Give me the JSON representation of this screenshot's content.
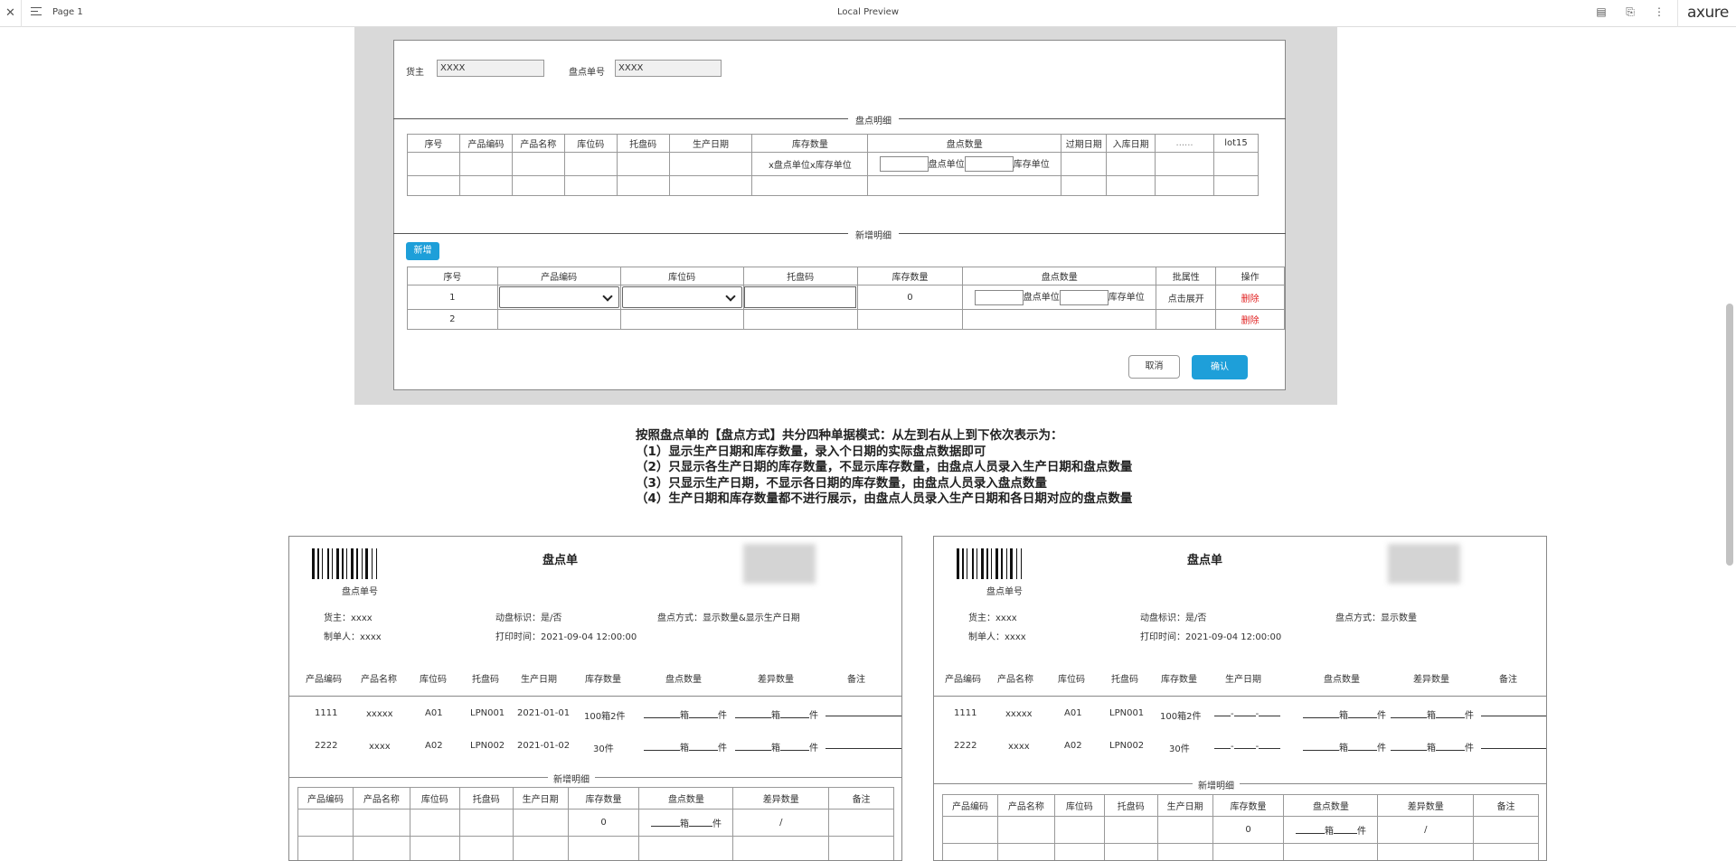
{
  "topbar": {
    "page": "Page 1",
    "title": "Local Preview",
    "brand": "axure"
  },
  "form": {
    "owner_label": "货主",
    "owner_value": "XXXX",
    "order_label": "盘点单号",
    "order_value": "XXXX",
    "section1": "盘点明细",
    "detail_headers": [
      "序号",
      "产品编码",
      "产品名称",
      "库位码",
      "托盘码",
      "生产日期",
      "库存数量",
      "盘点数量",
      "过期日期",
      "入库日期",
      "......",
      "lot15"
    ],
    "stock_unit_text": "x盘点单位x库存单位",
    "count_unit1": "盘点单位",
    "count_unit2": "库存单位",
    "section2": "新增明细",
    "add_button": "新增",
    "add_headers": [
      "序号",
      "产品编码",
      "库位码",
      "托盘码",
      "库存数量",
      "盘点数量",
      "批属性",
      "操作"
    ],
    "row1_no": "1",
    "row1_stock": "0",
    "row1_attr": "点击展开",
    "delete": "删除",
    "row2_no": "2",
    "cancel": "取消",
    "confirm": "确认"
  },
  "notes": [
    "按照盘点单的【盘点方式】共分四种单据模式：从左到右从上到下依次表示为：",
    "（1）显示生产日期和库存数量，录入个日期的实际盘点数据即可",
    "（2）只显示各生产日期的库存数量，不显示库存数量，由盘点人员录入生产日期和盘点数量",
    "（3）只显示生产日期，不显示各日期的库存数量，由盘点人员录入盘点数量",
    "（4）生产日期和库存数量都不进行展示，由盘点人员录入生产日期和各日期对应的盘点数量"
  ],
  "doc_left": {
    "title": "盘点单",
    "barcode_label": "盘点单号",
    "owner": "货主：xxxx",
    "maker": "制单人：xxxx",
    "dyn": "动盘标识：是/否",
    "print": "打印时间：2021-09-04 12:00:00",
    "mode": "盘点方式：显示数量&显示生产日期",
    "headers": [
      "产品编码",
      "产品名称",
      "库位码",
      "托盘码",
      "生产日期",
      "库存数量",
      "盘点数量",
      "差异数量",
      "备注"
    ],
    "rows": [
      [
        "1111",
        "xxxxx",
        "A01",
        "LPN001",
        "2021-01-01",
        "100箱2件"
      ],
      [
        "2222",
        "xxxx",
        "A02",
        "LPN002",
        "2021-01-02",
        "30件"
      ]
    ],
    "add_title": "新增明细",
    "add_headers": [
      "产品编码",
      "产品名称",
      "库位码",
      "托盘码",
      "生产日期",
      "库存数量",
      "盘点数量",
      "差异数量",
      "备注"
    ],
    "add_stock": "0",
    "add_diff": "/"
  },
  "doc_right": {
    "title": "盘点单",
    "barcode_label": "盘点单号",
    "owner": "货主：xxxx",
    "maker": "制单人：xxxx",
    "dyn": "动盘标识：是/否",
    "print": "打印时间：2021-09-04 12:00:00",
    "mode": "盘点方式：显示数量",
    "headers": [
      "产品编码",
      "产品名称",
      "库位码",
      "托盘码",
      "库存数量",
      "生产日期",
      "盘点数量",
      "差异数量",
      "备注"
    ],
    "rows": [
      [
        "1111",
        "xxxxx",
        "A01",
        "LPN001",
        "100箱2件"
      ],
      [
        "2222",
        "xxxx",
        "A02",
        "LPN002",
        "30件"
      ]
    ],
    "add_title": "新增明细",
    "add_headers": [
      "产品编码",
      "产品名称",
      "库位码",
      "托盘码",
      "生产日期",
      "库存数量",
      "盘点数量",
      "差异数量",
      "备注"
    ],
    "add_stock": "0",
    "add_diff": "/"
  },
  "units": {
    "box": "箱",
    "piece": "件"
  }
}
